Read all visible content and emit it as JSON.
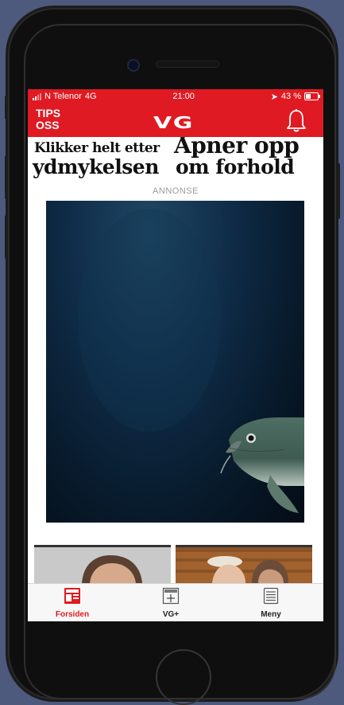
{
  "status_bar": {
    "carrier": "N Telenor",
    "network": "4G",
    "time": "21:00",
    "battery": "43 %"
  },
  "nav": {
    "tips_label": "TIPS OSS",
    "logo": "VG"
  },
  "headlines": {
    "left_line1": "Klikker helt etter",
    "left_line2": "ydmykelsen",
    "right_line1": "Åpner opp",
    "right_line2": "om forhold"
  },
  "ad": {
    "label": "ANNONSE"
  },
  "tabs": [
    {
      "label": "Forsiden",
      "icon": "forsiden-icon",
      "active": true
    },
    {
      "label": "VG+",
      "icon": "vgplus-icon",
      "active": false
    },
    {
      "label": "Meny",
      "icon": "menu-icon",
      "active": false
    }
  ],
  "colors": {
    "brand_red": "#e01a22",
    "background": "#4d5a7e"
  }
}
